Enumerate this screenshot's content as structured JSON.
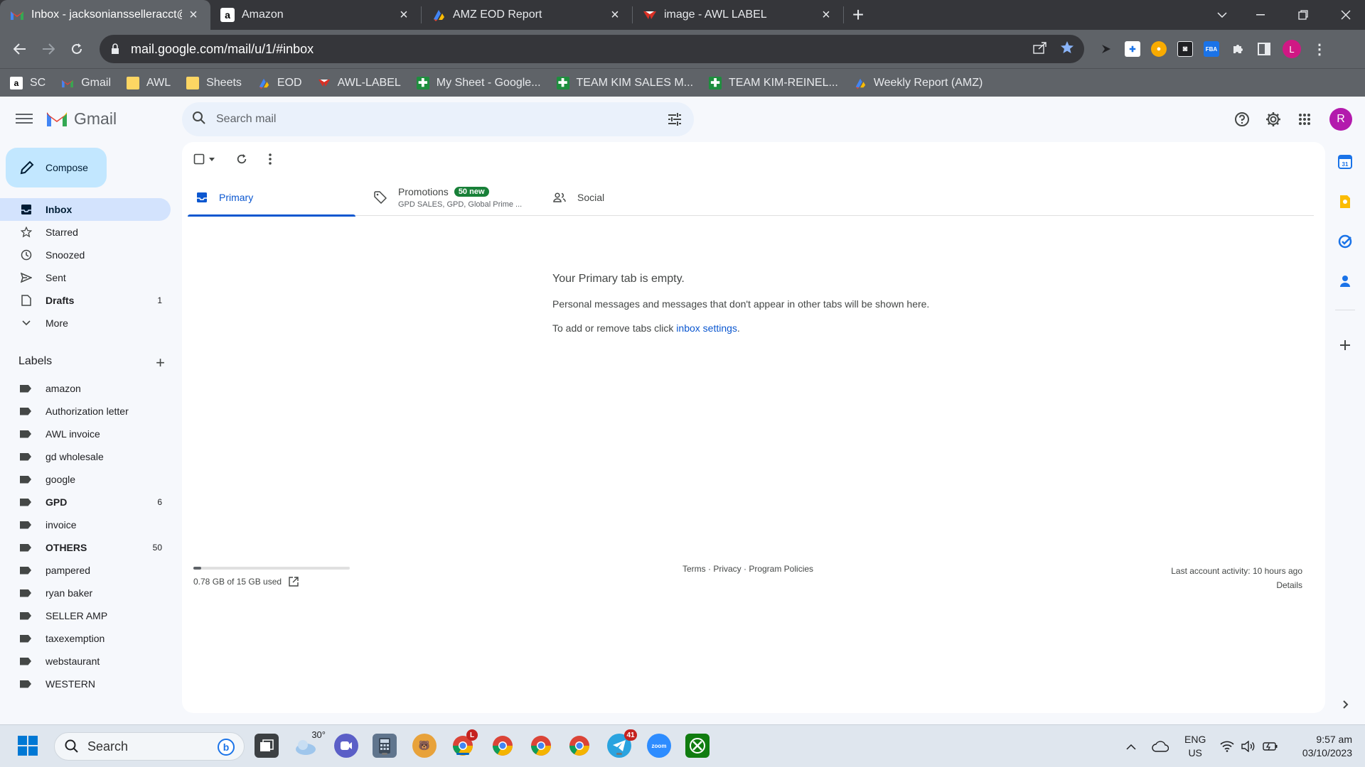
{
  "browser": {
    "tabs": [
      {
        "title": "Inbox - jacksoniansselleracct@gm",
        "active": true,
        "icon": "gmail-icon"
      },
      {
        "title": "Amazon",
        "active": false,
        "icon": "amazon-icon"
      },
      {
        "title": "AMZ EOD Report",
        "active": false,
        "icon": "report-icon"
      },
      {
        "title": "image - AWL LABEL",
        "active": false,
        "icon": "awl-icon"
      }
    ],
    "url": "mail.google.com/mail/u/1/#inbox",
    "profile_initial": "L",
    "bookmarks": [
      {
        "label": "SC",
        "icon": "amazon-icon"
      },
      {
        "label": "Gmail",
        "icon": "gmail-icon"
      },
      {
        "label": "AWL",
        "icon": "folder-icon"
      },
      {
        "label": "Sheets",
        "icon": "folder-icon"
      },
      {
        "label": "EOD",
        "icon": "report-icon"
      },
      {
        "label": "AWL-LABEL",
        "icon": "awl-icon"
      },
      {
        "label": "My Sheet - Google...",
        "icon": "sheets-icon"
      },
      {
        "label": "TEAM KIM SALES M...",
        "icon": "sheets-icon"
      },
      {
        "label": "TEAM KIM-REINEL...",
        "icon": "sheets-icon"
      },
      {
        "label": "Weekly Report (AMZ)",
        "icon": "report-icon"
      }
    ]
  },
  "gmail": {
    "logo_text": "Gmail",
    "search_placeholder": "Search mail",
    "account_initial": "R",
    "compose_label": "Compose",
    "nav": [
      {
        "label": "Inbox",
        "icon": "inbox-icon",
        "active": true,
        "count": ""
      },
      {
        "label": "Starred",
        "icon": "star-icon",
        "count": ""
      },
      {
        "label": "Snoozed",
        "icon": "clock-icon",
        "count": ""
      },
      {
        "label": "Sent",
        "icon": "send-icon",
        "count": ""
      },
      {
        "label": "Drafts",
        "icon": "draft-icon",
        "bold": true,
        "count": "1"
      },
      {
        "label": "More",
        "icon": "chevron-down-icon",
        "count": ""
      }
    ],
    "labels_heading": "Labels",
    "labels": [
      {
        "label": "amazon",
        "count": ""
      },
      {
        "label": "Authorization letter",
        "count": ""
      },
      {
        "label": "AWL invoice",
        "count": ""
      },
      {
        "label": "gd wholesale",
        "count": ""
      },
      {
        "label": "google",
        "count": ""
      },
      {
        "label": "GPD",
        "count": "6",
        "bold": true
      },
      {
        "label": "invoice",
        "count": ""
      },
      {
        "label": "OTHERS",
        "count": "50",
        "bold": true
      },
      {
        "label": "pampered",
        "count": ""
      },
      {
        "label": "ryan baker",
        "count": ""
      },
      {
        "label": "SELLER AMP",
        "count": ""
      },
      {
        "label": "taxexemption",
        "count": ""
      },
      {
        "label": "webstaurant",
        "count": ""
      },
      {
        "label": "WESTERN",
        "count": ""
      }
    ],
    "tabs": {
      "primary": "Primary",
      "promotions": "Promotions",
      "promotions_badge": "50 new",
      "promotions_sub": "GPD SALES, GPD, Global Prime ...",
      "social": "Social"
    },
    "empty": {
      "heading": "Your Primary tab is empty.",
      "line1": "Personal messages and messages that don't appear in other tabs will be shown here.",
      "line2_prefix": "To add or remove tabs click ",
      "line2_link": "inbox settings",
      "line2_suffix": "."
    },
    "footer": {
      "storage": "0.78 GB of 15 GB used",
      "storage_fraction": 0.052,
      "links": "Terms · Privacy · Program Policies",
      "last_activity": "Last account activity: 10 hours ago",
      "details": "Details"
    }
  },
  "taskbar": {
    "search_label": "Search",
    "weather": "30°",
    "lang_1": "ENG",
    "lang_2": "US",
    "time": "9:57 am",
    "date": "03/10/2023",
    "badge_telegram": "41"
  }
}
